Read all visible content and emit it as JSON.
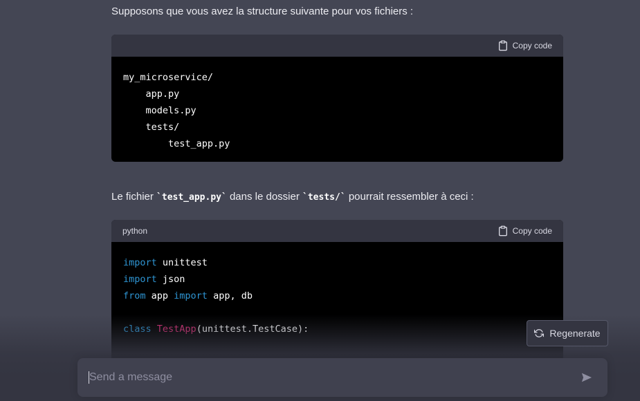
{
  "messages": {
    "intro": "Supposons que vous avez la structure suivante pour vos fichiers :",
    "second_pre": "Le fichier ",
    "second_code1": "`test_app.py`",
    "second_mid": " dans le dossier ",
    "second_code2": "`tests/`",
    "second_post": " pourrait ressembler à ceci :"
  },
  "code_block_1": {
    "language": "",
    "copy_label": "Copy code",
    "lines": [
      "my_microservice/",
      "    app.py",
      "    models.py",
      "    tests/",
      "        test_app.py"
    ]
  },
  "code_block_2": {
    "language": "python",
    "copy_label": "Copy code",
    "line1_kw": "import",
    "line1_rest": " unittest",
    "line2_kw": "import",
    "line2_rest": " json",
    "line3_kw1": "from",
    "line3_mid": " app ",
    "line3_kw2": "import",
    "line3_rest": " app, db",
    "line5_kw": "class",
    "line5_cls": "TestApp",
    "line5_rest": "(unittest.TestCase):"
  },
  "regenerate": {
    "label": "Regenerate"
  },
  "composer": {
    "placeholder": "Send a message"
  },
  "colors": {
    "background": "#444654",
    "code_bg": "#000000",
    "code_header": "#343541",
    "keyword": "#2e95d3",
    "class_name": "#df3079"
  }
}
